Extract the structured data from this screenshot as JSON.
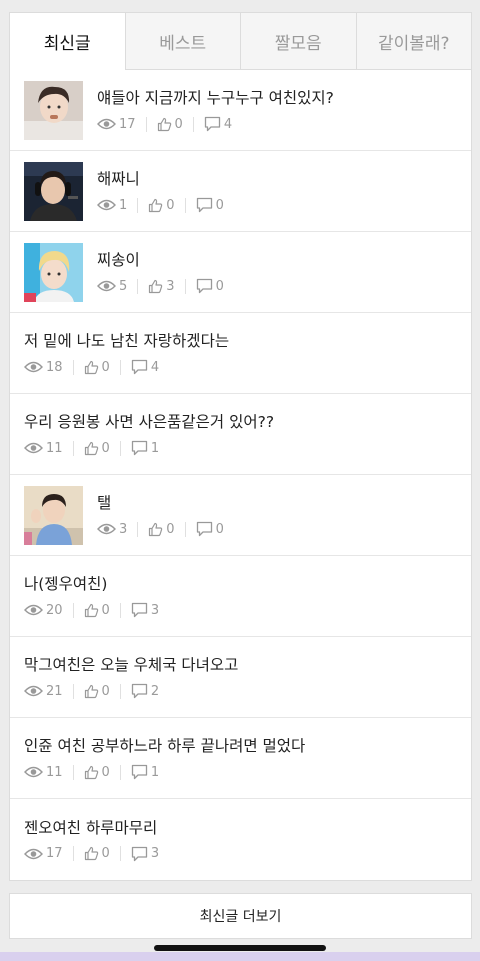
{
  "tabs": [
    {
      "label": "최신글",
      "active": true
    },
    {
      "label": "베스트",
      "active": false
    },
    {
      "label": "짤모음",
      "active": false
    },
    {
      "label": "같이볼래?",
      "active": false
    }
  ],
  "posts": [
    {
      "title": "얘들아 지금까지 누구누구 여친있지?",
      "views": "17",
      "likes": "0",
      "comments": "4",
      "thumbnail": "boy-selfie"
    },
    {
      "title": "해짜니",
      "views": "1",
      "likes": "0",
      "comments": "0",
      "thumbnail": "boy-headphones"
    },
    {
      "title": "찌송이",
      "views": "5",
      "likes": "3",
      "comments": "0",
      "thumbnail": "blond-boy"
    },
    {
      "title": "저 밑에 나도 남친 자랑하겠다는",
      "views": "18",
      "likes": "0",
      "comments": "4",
      "thumbnail": null
    },
    {
      "title": "우리 응원봉 사면 사은품같은거 있어??",
      "views": "11",
      "likes": "0",
      "comments": "1",
      "thumbnail": null
    },
    {
      "title": "탤",
      "views": "3",
      "likes": "0",
      "comments": "0",
      "thumbnail": "boy-waving"
    },
    {
      "title": "나(젱우여친)",
      "views": "20",
      "likes": "0",
      "comments": "3",
      "thumbnail": null
    },
    {
      "title": "막그여친은 오늘 우체국 다녀오고",
      "views": "21",
      "likes": "0",
      "comments": "2",
      "thumbnail": null
    },
    {
      "title": "인쥰 여친 공부하느라 하루 끝나려면 멀었다",
      "views": "11",
      "likes": "0",
      "comments": "1",
      "thumbnail": null
    },
    {
      "title": "젠오여친 하루마무리",
      "views": "17",
      "likes": "0",
      "comments": "3",
      "thumbnail": null
    }
  ],
  "more_label": "최신글 더보기",
  "icons": {
    "views": "eye-icon",
    "likes": "thumbs-up-icon",
    "comments": "comment-icon"
  },
  "colors": {
    "background": "#ececec",
    "active_tab_text": "#111111",
    "inactive_tab_text": "#9a9a9a",
    "meta_text": "#9a9a9a",
    "bottom_strip": "#d9d0ee"
  }
}
